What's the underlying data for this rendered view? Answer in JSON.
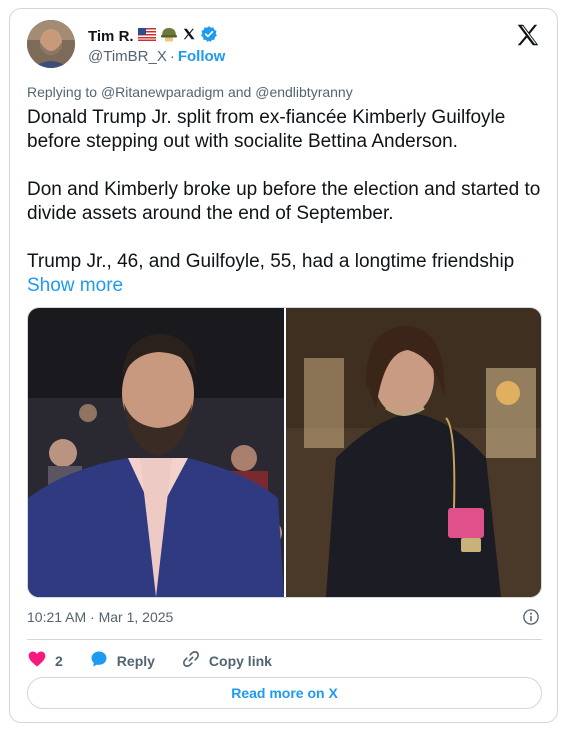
{
  "author": {
    "name": "Tim R.",
    "handle": "@TimBR_X",
    "follow_label": "Follow",
    "verified_icon": "verified-badge-icon",
    "flag_icon": "us-flag-icon",
    "helmet_icon": "military-helmet-icon",
    "x_icon": "x-logo-icon"
  },
  "reply": {
    "prefix": "Replying to ",
    "targets": "@Ritanewparadigm and @endlibtyranny"
  },
  "tweet": {
    "paragraph1": "Donald Trump Jr. split from ex-fiancée Kimberly Guilfoyle before stepping out with socialite Bettina Anderson.",
    "paragraph2": "Don and Kimberly broke up before the election and started to divide assets around the end of September.",
    "paragraph3": "Trump Jr., 46, and Guilfoyle, 55, had a longtime friendship",
    "show_more": "Show more"
  },
  "meta": {
    "timestamp": "10:21 AM · Mar 1, 2025"
  },
  "actions": {
    "like_count": "2",
    "reply_label": "Reply",
    "copy_label": "Copy link"
  },
  "read_more": "Read more on X",
  "colors": {
    "accent": "#1d9bf0",
    "like": "#f91880",
    "text": "#0f1419",
    "muted": "#536471",
    "border": "#cfd9de"
  }
}
